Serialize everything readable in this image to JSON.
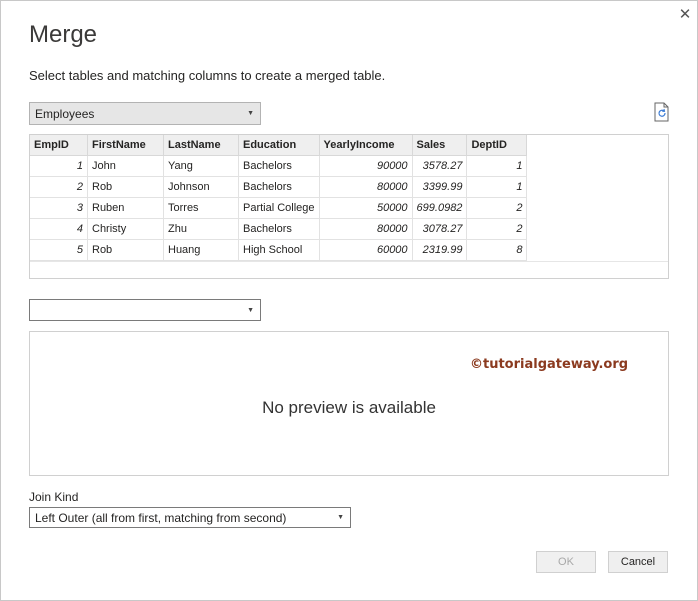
{
  "dialog": {
    "title": "Merge",
    "instructions": "Select tables and matching columns to create a merged table.",
    "close_icon": "close-icon"
  },
  "table1": {
    "selected": "Employees",
    "refresh_icon": "refresh-file-icon",
    "columns": [
      "EmpID",
      "FirstName",
      "LastName",
      "Education",
      "YearlyIncome",
      "Sales",
      "DeptID"
    ],
    "rows": [
      [
        "1",
        "John",
        "Yang",
        "Bachelors",
        "90000",
        "3578.27",
        "1"
      ],
      [
        "2",
        "Rob",
        "Johnson",
        "Bachelors",
        "80000",
        "3399.99",
        "1"
      ],
      [
        "3",
        "Ruben",
        "Torres",
        "Partial College",
        "50000",
        "699.0982",
        "2"
      ],
      [
        "4",
        "Christy",
        "Zhu",
        "Bachelors",
        "80000",
        "3078.27",
        "2"
      ],
      [
        "5",
        "Rob",
        "Huang",
        "High School",
        "60000",
        "2319.99",
        "8"
      ]
    ]
  },
  "table2": {
    "selected": "",
    "no_preview_text": "No preview is available",
    "watermark": "©tutorialgateway.org"
  },
  "join": {
    "label": "Join Kind",
    "selected": "Left Outer (all from first, matching from second)"
  },
  "buttons": {
    "ok": "OK",
    "cancel": "Cancel"
  }
}
